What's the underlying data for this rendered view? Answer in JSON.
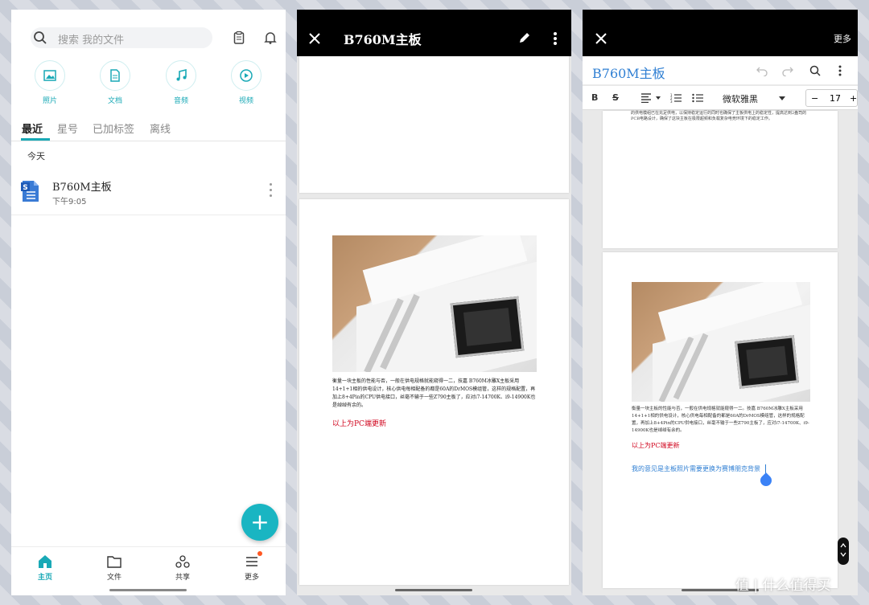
{
  "panel1": {
    "search_placeholder": "搜索 我的文件",
    "categories": [
      {
        "icon": "image-icon",
        "label": "照片"
      },
      {
        "icon": "document-icon",
        "label": "文档"
      },
      {
        "icon": "music-icon",
        "label": "音频"
      },
      {
        "icon": "play-icon",
        "label": "视频"
      }
    ],
    "tabs": [
      "最近",
      "星号",
      "已加标签",
      "离线"
    ],
    "section_label": "今天",
    "file": {
      "name": "B760M主板",
      "time": "下午9:05"
    },
    "fab_label": "+",
    "nav": [
      {
        "icon": "home-icon",
        "label": "主页"
      },
      {
        "icon": "folder-icon",
        "label": "文件"
      },
      {
        "icon": "share-icon",
        "label": "共享"
      },
      {
        "icon": "menu-icon",
        "label": "更多"
      }
    ],
    "accent_color": "#19a9b6"
  },
  "panel2": {
    "title": "B760M主板",
    "body_text": "衡量一块主板的性能与否，一般在供电规格就能窥得一二，技嘉 B760M冰雕X主板采用14+1+1相的供电设计，核心供电每相配备的都是60A的DrMOS模组管，这样的规格配置，再加上8+4Pin的CPU供电接口，丝毫不输于一些Z790主板了，应对i7-14700K、i9-14900K也是绰绰有余的。",
    "red_text": "以上为PC端更新"
  },
  "panel3": {
    "more_label": "更多",
    "title": "B760M主板",
    "toolbar": {
      "bold": "B",
      "strike": "S",
      "font": "微软雅黑",
      "minus": "−",
      "size": "17",
      "plus": "+"
    },
    "top_text": "的供电模组已在充足供电，以保持稳定运行的同时也确保了主板供电上的稳定性，提高达到2盎司的PCB电路设计，确保了这块主板在极限超频和负载复杂电竞环境下的稳定工作。",
    "body_text": "衡量一块主板的性能与否，一般在供电规格就能窥得一二。技嘉 B760M冰雕X主板采用14+1+1相的供电设计，核心供电每相配备的都是60A的DrMOS模组管，这样的规格配置，再加上8+4Pin的CPU供电接口，丝毫不输于一些Z790主板了，应对i7-14700K、i9-14900K也是绰绰有余的。",
    "red_text": "以上为PC端更新",
    "blue_text": "我的意见是主板照片需要更换为赛博朋克背景"
  },
  "watermark": "值 | 什么值得买"
}
